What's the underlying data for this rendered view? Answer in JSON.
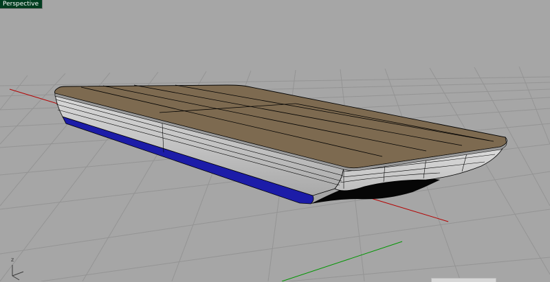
{
  "viewport": {
    "title": "Perspective",
    "background": "#a6a6a6",
    "grid_color": "#949494",
    "x_axis_color": "#b40000",
    "y_axis_color": "#009600",
    "axis_label": "z"
  },
  "model": {
    "deck_color": "#7d6a50",
    "hull_color": "#c4c4c4",
    "bottom_stripe_color": "#1c1ca8"
  }
}
